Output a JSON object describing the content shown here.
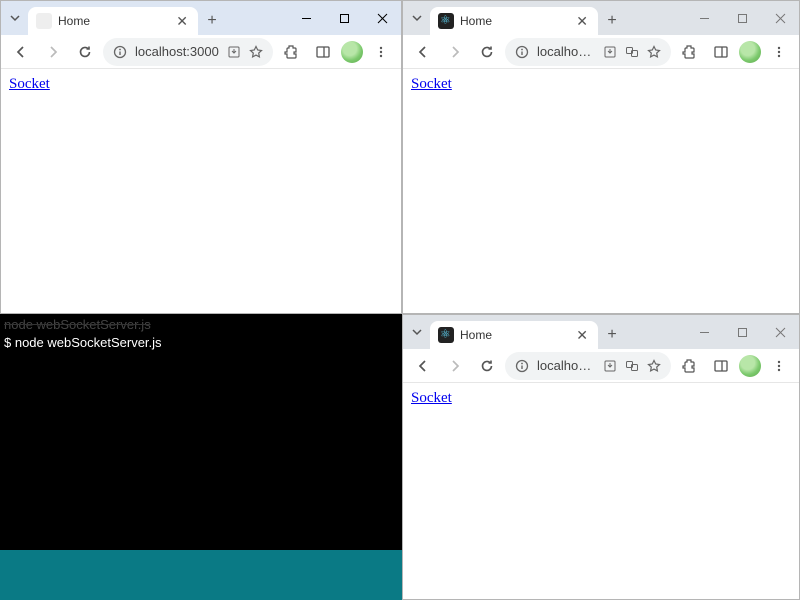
{
  "browser1": {
    "tab_title": "Home",
    "url": "localhost:3000",
    "page_link": "Socket"
  },
  "browser2": {
    "tab_title": "Home",
    "url": "localhos…",
    "page_link": "Socket"
  },
  "browser3": {
    "tab_title": "Home",
    "url": "localhos…",
    "page_link": "Socket"
  },
  "terminal": {
    "ghost_line": "node webSocketServer.js",
    "prompt": "$ ",
    "command": "node webSocketServer.js"
  }
}
